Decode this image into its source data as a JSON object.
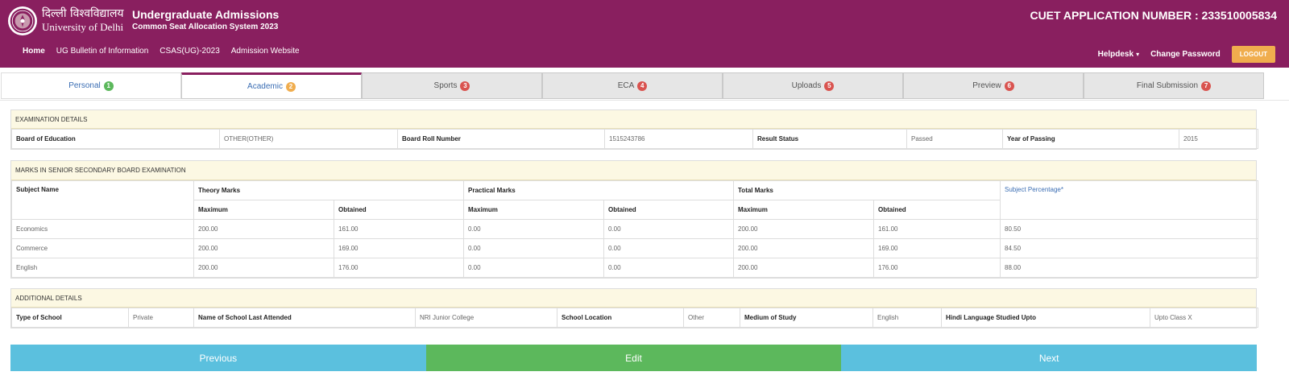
{
  "header": {
    "university_hindi": "दिल्ली विश्वविद्यालय",
    "university_english": "University of Delhi",
    "title": "Undergraduate Admissions",
    "subtitle": "Common Seat Allocation System 2023",
    "application_number": "CUET APPLICATION NUMBER : 233510005834",
    "logo_icon": "university-seal-icon"
  },
  "nav": {
    "home": "Home",
    "bulletin": "UG Bulletin of Information",
    "csas": "CSAS(UG)-2023",
    "admission": "Admission Website",
    "helpdesk": "Helpdesk",
    "change_password": "Change Password",
    "logout": "LOGOUT"
  },
  "tabs": [
    {
      "label": "Personal",
      "num": "1"
    },
    {
      "label": "Academic",
      "num": "2"
    },
    {
      "label": "Sports",
      "num": "3"
    },
    {
      "label": "ECA",
      "num": "4"
    },
    {
      "label": "Uploads",
      "num": "5"
    },
    {
      "label": "Preview",
      "num": "6"
    },
    {
      "label": "Final Submission",
      "num": "7"
    }
  ],
  "exam": {
    "heading": "EXAMINATION DETAILS",
    "board_label": "Board of Education",
    "board_value": "OTHER(OTHER)",
    "roll_label": "Board Roll Number",
    "roll_value": "1515243786",
    "result_label": "Result Status",
    "result_value": "Passed",
    "year_label": "Year of Passing",
    "year_value": "2015"
  },
  "marks": {
    "heading": "MARKS IN SENIOR SECONDARY BOARD EXAMINATION",
    "col_subject": "Subject Name",
    "col_theory": "Theory Marks",
    "col_practical": "Practical Marks",
    "col_total": "Total Marks",
    "col_percentage": "Subject Percentage",
    "required_mark": "*",
    "sub_max": "Maximum",
    "sub_obtained": "Obtained",
    "rows": [
      {
        "subject": "Economics",
        "theory_max": "200.00",
        "theory_obt": "161.00",
        "prac_max": "0.00",
        "prac_obt": "0.00",
        "total_max": "200.00",
        "total_obt": "161.00",
        "pct": "80.50"
      },
      {
        "subject": "Commerce",
        "theory_max": "200.00",
        "theory_obt": "169.00",
        "prac_max": "0.00",
        "prac_obt": "0.00",
        "total_max": "200.00",
        "total_obt": "169.00",
        "pct": "84.50"
      },
      {
        "subject": "English",
        "theory_max": "200.00",
        "theory_obt": "176.00",
        "prac_max": "0.00",
        "prac_obt": "0.00",
        "total_max": "200.00",
        "total_obt": "176.00",
        "pct": "88.00"
      }
    ]
  },
  "additional": {
    "heading": "ADDITIONAL DETAILS",
    "school_type_label": "Type of School",
    "school_type_value": "Private",
    "school_name_label": "Name of School Last Attended",
    "school_name_value": "NRI Junior College",
    "location_label": "School Location",
    "location_value": "Other",
    "medium_label": "Medium of Study",
    "medium_value": "English",
    "hindi_label": "Hindi Language Studied Upto",
    "hindi_value": "Upto Class X"
  },
  "buttons": {
    "previous": "Previous",
    "edit": "Edit",
    "next": "Next"
  },
  "colors": {
    "header_bg": "#891f5f",
    "logout_bg": "#f0ad4e",
    "previous_next_bg": "#5bc0de",
    "edit_bg": "#5cb85c",
    "section_head_bg": "#fcf8e3"
  }
}
